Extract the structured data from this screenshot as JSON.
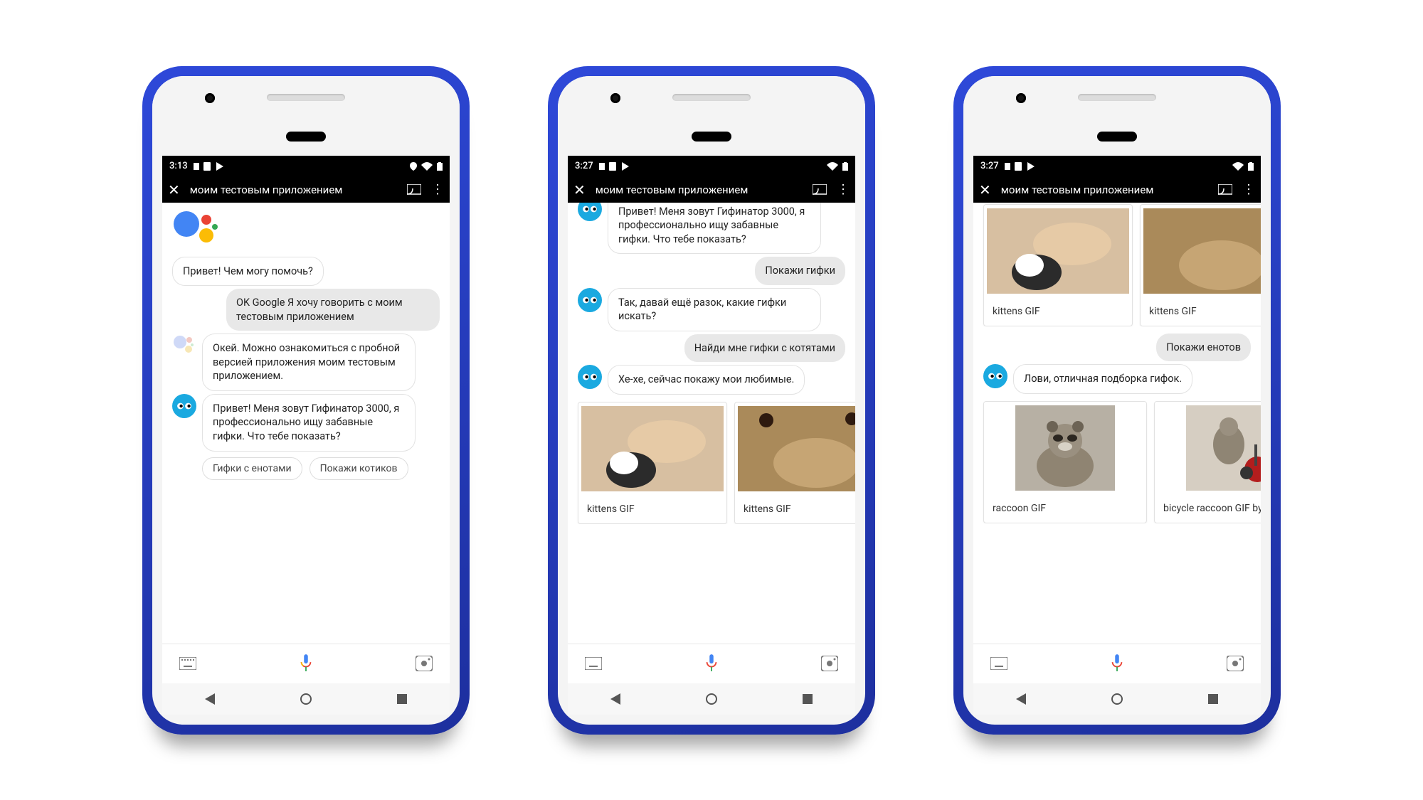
{
  "phones": [
    {
      "statusbar": {
        "time": "3:13"
      },
      "appbar": {
        "title": "моим тестовым приложением"
      },
      "messages": [
        {
          "from": "assistant_simple",
          "text": "Привет! Чем могу помочь?"
        },
        {
          "from": "user",
          "text": "OK Google Я хочу говорить с моим тестовым приложением"
        },
        {
          "from": "ga",
          "text": "Окей. Можно ознакомиться с пробной версией приложения моим тестовым приложением."
        },
        {
          "from": "bot",
          "text": "Привет! Меня зовут Гифинатор 3000, я профессионально ищу забавные гифки. Что тебе показать?"
        }
      ],
      "chips": [
        "Гифки с енотами",
        "Покажи котиков"
      ]
    },
    {
      "statusbar": {
        "time": "3:27"
      },
      "appbar": {
        "title": "моим тестовым приложением"
      },
      "messages": [
        {
          "from": "bot_cut",
          "text": "Привет! Меня зовут Гифинатор 3000, я профессионально ищу забавные гифки. Что тебе показать?"
        },
        {
          "from": "user",
          "text": "Покажи гифки"
        },
        {
          "from": "bot",
          "text": "Так, давай ещё разок, какие гифки искать?"
        },
        {
          "from": "user",
          "text": "Найди мне гифки с котятами"
        },
        {
          "from": "bot",
          "text": "Хе-хе, сейчас покажу мои любимые."
        }
      ],
      "cards": [
        {
          "label": "kittens GIF",
          "kind": "kittens1"
        },
        {
          "label": "kittens GIF",
          "kind": "kittens2"
        }
      ]
    },
    {
      "statusbar": {
        "time": "3:27"
      },
      "appbar": {
        "title": "моим тестовым приложением"
      },
      "topCards": [
        {
          "label": "kittens GIF",
          "kind": "kittens1"
        },
        {
          "label": "kittens GIF",
          "kind": "kittens2"
        }
      ],
      "messages": [
        {
          "from": "user",
          "text": "Покажи енотов"
        },
        {
          "from": "bot",
          "text": "Лови, отличная подборка гифок."
        }
      ],
      "cards": [
        {
          "label": "raccoon GIF",
          "kind": "raccoon1"
        },
        {
          "label": "bicycle raccoon GIF by Cyclery",
          "kind": "raccoon2"
        }
      ]
    }
  ]
}
